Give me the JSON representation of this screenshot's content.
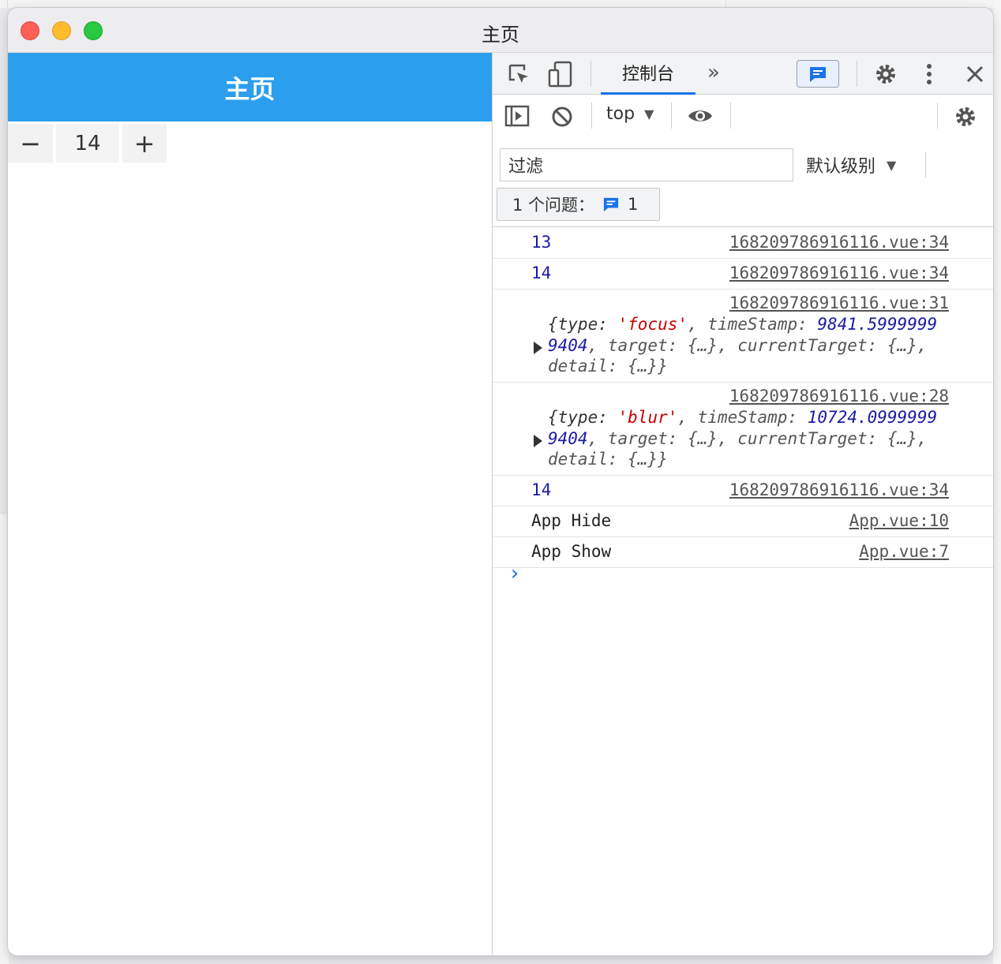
{
  "window": {
    "title": "主页"
  },
  "app": {
    "header_title": "主页",
    "stepper": {
      "minus": "−",
      "value": "14",
      "plus": "+"
    }
  },
  "devtools": {
    "tabs": {
      "console": "控制台",
      "more": "»"
    },
    "context": "top",
    "filter_placeholder": "过滤",
    "level": "默认级别",
    "issues": {
      "label": "1 个问题：",
      "count": "1"
    },
    "logs": [
      {
        "value": "13",
        "source": "168209786916116.vue:34"
      },
      {
        "value": "14",
        "source": "168209786916116.vue:34"
      },
      {
        "source": "168209786916116.vue:31",
        "l1a": "{type: ",
        "l1b": "'focus'",
        "l1c": ", timeStamp: ",
        "l1d": "9841.5999999",
        "l2a": "9404",
        "l2b": ", target: {…}, currentTarget: {…},",
        "l3": "detail: {…}}"
      },
      {
        "source": "168209786916116.vue:28",
        "l1a": "{type: ",
        "l1b": "'blur'",
        "l1c": ", timeStamp: ",
        "l1d": "10724.0999999",
        "l2a": "9404",
        "l2b": ", target: {…}, currentTarget: {…},",
        "l3": "detail: {…}}"
      },
      {
        "value": "14",
        "source": "168209786916116.vue:34"
      },
      {
        "text": "App Hide",
        "source": "App.vue:10"
      },
      {
        "text": "App Show",
        "source": "App.vue:7"
      }
    ],
    "prompt": "›"
  },
  "colors": {
    "accent": "#2c9eee",
    "devtools_blue": "#1a73e8"
  }
}
